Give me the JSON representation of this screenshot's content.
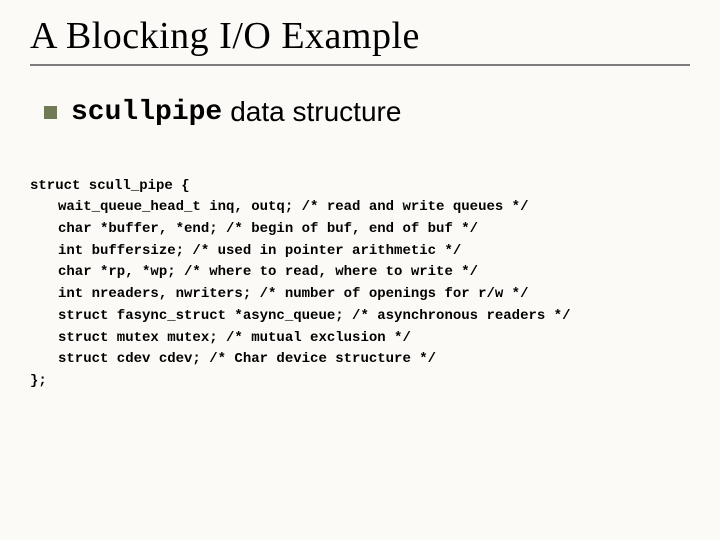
{
  "title": "A Blocking I/O Example",
  "subtitle": {
    "code": "scullpipe",
    "text": "data structure"
  },
  "code": {
    "l0": "struct scull_pipe {",
    "l1": "wait_queue_head_t inq, outq; /* read and write queues */",
    "l2": "char *buffer, *end; /* begin of buf, end of buf */",
    "l3": "int buffersize; /* used in pointer arithmetic */",
    "l4": "char *rp, *wp; /* where to read, where to write */",
    "l5": "int nreaders, nwriters; /* number of openings for r/w */",
    "l6": "struct fasync_struct *async_queue; /* asynchronous readers */",
    "l7": "struct mutex mutex; /* mutual exclusion */",
    "l8": "struct cdev cdev; /* Char device structure */",
    "l9": "};"
  }
}
